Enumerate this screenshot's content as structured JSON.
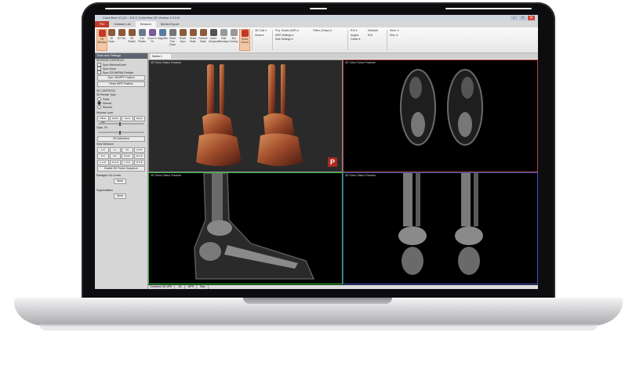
{
  "window": {
    "title": "CubeView 10 (10 - 2017) CubeView 3D Version 1.0.0.8"
  },
  "window_buttons": [
    "–",
    "□",
    "✕"
  ],
  "menu_tabs": [
    {
      "label": "File"
    },
    {
      "label": "Dataset List"
    },
    {
      "label": "Session"
    },
    {
      "label": "Media Export"
    }
  ],
  "ribbon": {
    "buttons": [
      {
        "label": "Fill Window",
        "icon": "hand-icon"
      },
      {
        "label": "3D Zoom",
        "icon": "zoom-icon"
      },
      {
        "label": "3D Pan",
        "icon": "pan-icon"
      },
      {
        "label": "3D Rotate",
        "icon": "rotate-icon"
      },
      {
        "label": "Cut Planes",
        "icon": "cut-icon"
      },
      {
        "label": "Zoom to Fit",
        "icon": "fit-icon"
      },
      {
        "label": "Magnifier",
        "icon": "magnifier-icon"
      },
      {
        "label": "Reset Pan Zoom",
        "icon": "reset-icon"
      },
      {
        "label": "Reset Sync",
        "icon": "sync-icon"
      },
      {
        "label": "Reset State",
        "icon": "state-icon"
      },
      {
        "label": "Restore State",
        "icon": "restore-icon"
      },
      {
        "label": "Invert Grayscale",
        "icon": "invert-icon"
      },
      {
        "label": "Hide Overlays",
        "icon": "overlay-icon"
      },
      {
        "label": "Text Overlay",
        "icon": "text-icon"
      },
      {
        "label": "Show Cursor",
        "icon": "cursor-icon"
      }
    ],
    "group1": [
      "3D Cuts ▾",
      "Views ▾"
    ],
    "group2": [
      "Proj. Modes (MIP) ▾",
      "MPR Settings ▾",
      "Slab Settings ▾"
    ],
    "group3": [
      "Filters (Sharp) ▾"
    ],
    "group4": [
      "ROI ▾",
      "Angles",
      "Cobbs ▾"
    ],
    "group5": [
      "Distance",
      "ROI"
    ],
    "group6": [
      "Sens. ▾",
      "Elim. ▾"
    ]
  },
  "panel": {
    "title": "Tools and Settings",
    "sync_section": "SESSION CONTROLS",
    "sync_options": [
      "Sync Window/Level",
      "Sync Zoom",
      "Sync ZOOM/PAN Position"
    ],
    "btn1": "Sync 3D/MPR Position",
    "btn2": "Reset MPR Position",
    "mpr_section": "3D CONTROLS",
    "render_label": "3D Render Type",
    "render_options": [
      "Fixed",
      "Normal",
      "Smooth"
    ],
    "window_label": "Window Level",
    "offset_label": "Offset (3D)",
    "offset_buttons": [
      "Fluids",
      "Hard",
      "Reset"
    ],
    "opacity_label": "Opac. Fit",
    "btn3": "3D Definitions",
    "view_section": "View Direction",
    "dir_buttons": [
      "A-P",
      "L-L",
      "AX",
      "L-R-P",
      "P-A",
      "R-L",
      "Down",
      "R-A-P",
      "L-A-D",
      "R-A-D",
      "L-P-D",
      "R-P-D"
    ],
    "btn4": "Enable 3D Frame Sequence",
    "managed_label": "Managed Cut Levels",
    "managed_value": "None",
    "seg_label": "Segmentation",
    "seg_value": "None"
  },
  "viewer": {
    "series_tab": "Series 1",
    "views": [
      {
        "label": "3D Tubor Distnc Fracture"
      },
      {
        "label": "3D Tubor Dorso Fracture"
      },
      {
        "label": "3D Tubor Distnc Fracture"
      },
      {
        "label": "3D Tubor Distnc Fracture"
      }
    ],
    "logo": "P"
  },
  "statusbar": [
    "Combined 3D MPR",
    "3D",
    "MPR",
    "Slab"
  ]
}
